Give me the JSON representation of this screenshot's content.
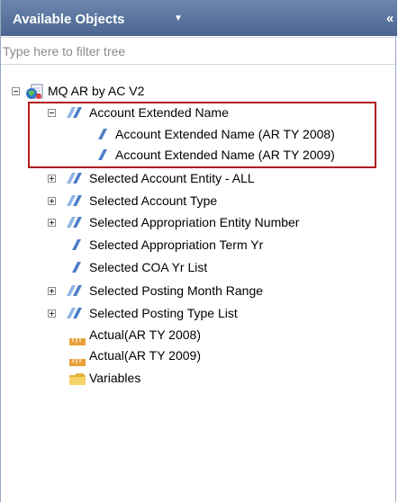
{
  "header": {
    "title": "Available Objects"
  },
  "filter": {
    "placeholder": "Type here to filter tree"
  },
  "tree": {
    "root": "MQ AR by AC V2",
    "items": [
      {
        "label": "Account Extended Name"
      },
      {
        "label": "Account Extended Name (AR TY 2008)"
      },
      {
        "label": "Account Extended Name (AR TY 2009)"
      },
      {
        "label": "Selected Account Entity - ALL"
      },
      {
        "label": "Selected Account Type"
      },
      {
        "label": "Selected Appropriation Entity Number"
      },
      {
        "label": "Selected Appropriation Term Yr"
      },
      {
        "label": "Selected COA Yr List"
      },
      {
        "label": "Selected Posting Month Range"
      },
      {
        "label": "Selected Posting Type List"
      },
      {
        "label": "Actual(AR TY 2008)"
      },
      {
        "label": "Actual(AR TY 2009)"
      },
      {
        "label": "Variables"
      }
    ]
  },
  "colors": {
    "header": "#5a75a0",
    "highlight": "#b01d1d",
    "dimension": "#4f7fc7",
    "measure": "#e8a23a",
    "folder": "#f2c94c"
  }
}
